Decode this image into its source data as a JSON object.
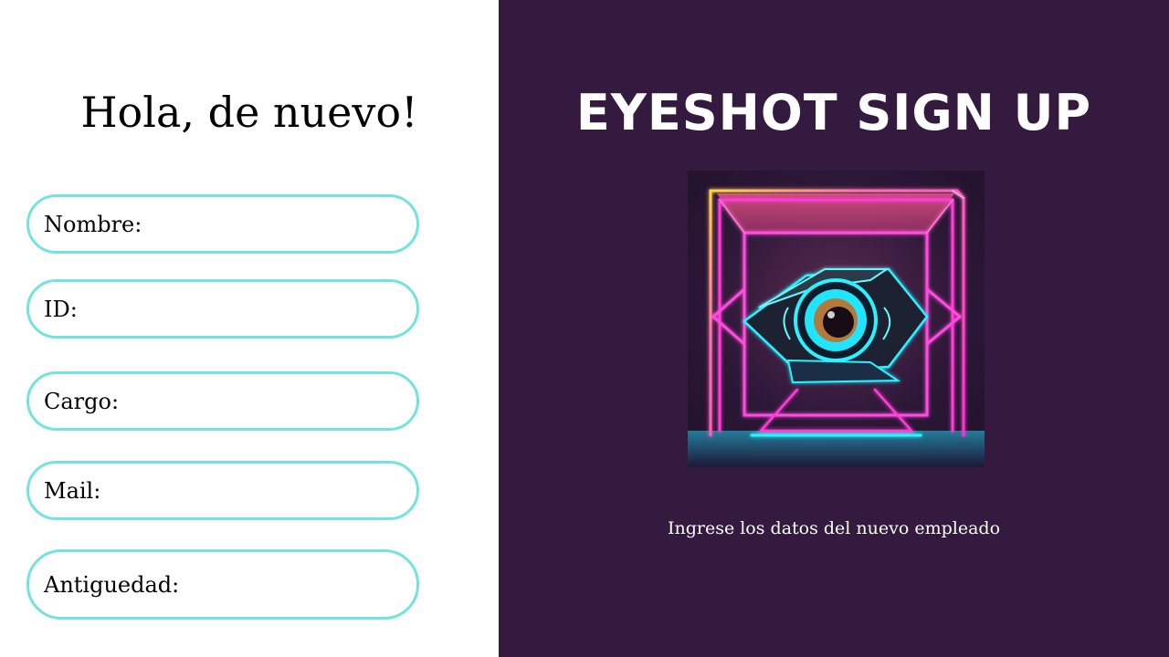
{
  "form": {
    "greeting": "Hola, de nuevo!",
    "fields": [
      {
        "label": "Nombre:",
        "value": ""
      },
      {
        "label": "ID:",
        "value": ""
      },
      {
        "label": "Cargo:",
        "value": ""
      },
      {
        "label": "Mail:",
        "value": ""
      },
      {
        "label": "Antiguedad:",
        "value": ""
      }
    ]
  },
  "hero": {
    "title": "EYESHOT SIGN UP",
    "logo_icon": "neon-eye-icon",
    "subtitle": "Ingrese los datos del nuevo empleado"
  },
  "colors": {
    "left_background": "#ffffff",
    "right_background": "#351a3f",
    "field_border": "#72e3de",
    "neon_pink": "#ff3ad8",
    "neon_cyan": "#29f2ff"
  }
}
